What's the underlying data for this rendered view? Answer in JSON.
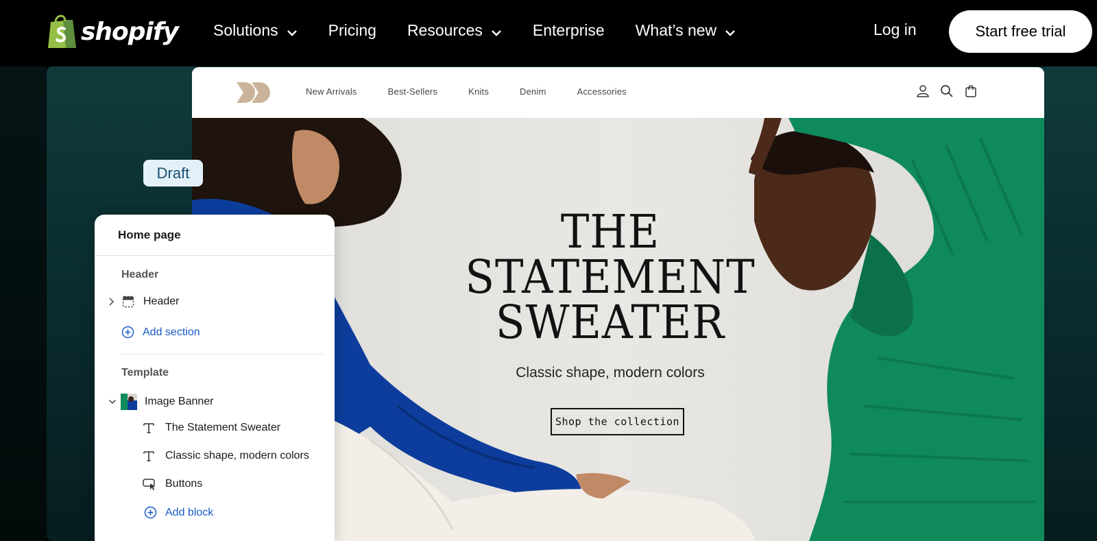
{
  "nav": {
    "brand": "shopify",
    "links": [
      {
        "label": "Solutions",
        "has_dropdown": true
      },
      {
        "label": "Pricing",
        "has_dropdown": false
      },
      {
        "label": "Resources",
        "has_dropdown": true
      },
      {
        "label": "Enterprise",
        "has_dropdown": false
      },
      {
        "label": "What’s new",
        "has_dropdown": true
      }
    ],
    "login_label": "Log in",
    "cta_label": "Start free trial"
  },
  "store": {
    "nav_items": [
      "New Arrivals",
      "Best-Sellers",
      "Knits",
      "Denim",
      "Accessories"
    ],
    "icons": [
      "account-icon",
      "search-icon",
      "cart-icon"
    ],
    "hero": {
      "title": "THE STATEMENT SWEATER",
      "subtitle": "Classic shape, modern colors",
      "button_label": "Shop the collection"
    }
  },
  "editor": {
    "badge": "Draft",
    "page_title": "Home page",
    "header_group_label": "Header",
    "header_item": "Header",
    "add_section_label": "Add section",
    "template_group_label": "Template",
    "banner_item": "Image Banner",
    "blocks": [
      {
        "label": "The Statement Sweater",
        "icon": "text-icon"
      },
      {
        "label": "Classic shape, modern colors",
        "icon": "text-icon"
      },
      {
        "label": "Buttons",
        "icon": "button-icon"
      }
    ],
    "add_block_label": "Add block"
  },
  "colors": {
    "nav_bg": "#000000",
    "stage_teal": "#0f3a3c",
    "store_logo": "#c9b49a",
    "link_blue": "#1a5bc7",
    "draft_badge_bg": "#e3f0f8",
    "sweater_blue": "#0d3d9c",
    "sweater_green": "#0f8a5a"
  }
}
